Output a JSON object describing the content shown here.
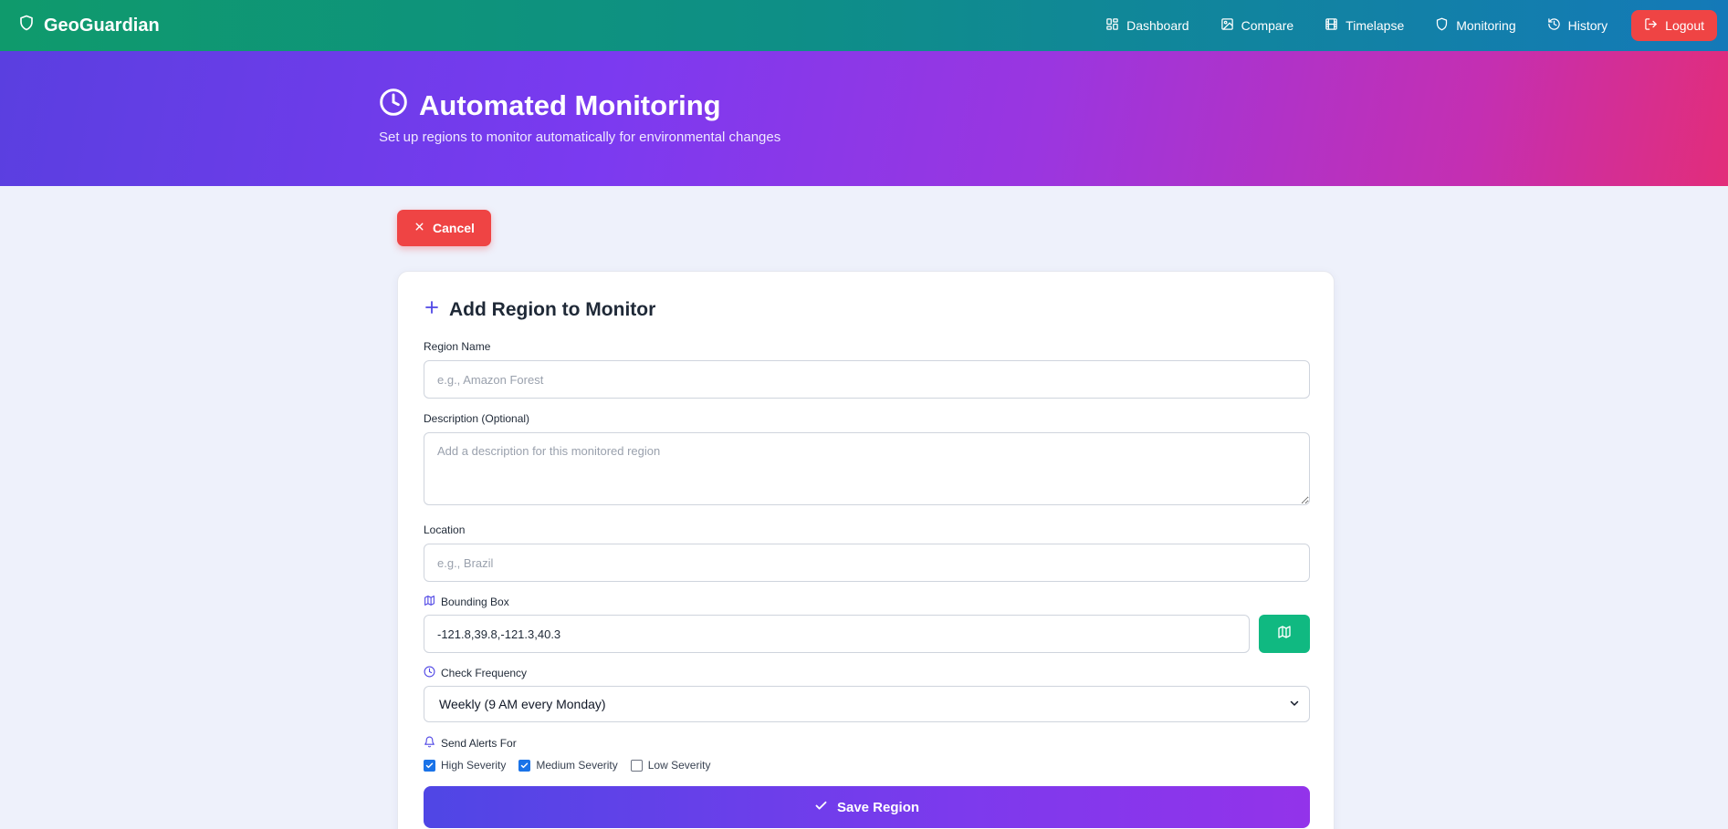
{
  "nav": {
    "brand": "GeoGuardian",
    "links": [
      {
        "label": "Dashboard",
        "icon": "dashboard-icon"
      },
      {
        "label": "Compare",
        "icon": "image-icon"
      },
      {
        "label": "Timelapse",
        "icon": "film-icon"
      },
      {
        "label": "Monitoring",
        "icon": "shield-icon"
      },
      {
        "label": "History",
        "icon": "history-icon"
      }
    ],
    "logout": "Logout"
  },
  "hero": {
    "title": "Automated Monitoring",
    "subtitle": "Set up regions to monitor automatically for environmental changes"
  },
  "cancel_label": "Cancel",
  "form": {
    "title": "Add Region to Monitor",
    "region_name": {
      "label": "Region Name",
      "placeholder": "e.g., Amazon Forest",
      "value": ""
    },
    "description": {
      "label": "Description (Optional)",
      "placeholder": "Add a description for this monitored region",
      "value": ""
    },
    "location": {
      "label": "Location",
      "placeholder": "e.g., Brazil",
      "value": ""
    },
    "bounding_box": {
      "label": "Bounding Box",
      "value": "-121.8,39.8,-121.3,40.3"
    },
    "check_frequency": {
      "label": "Check Frequency",
      "selected": "Weekly (9 AM every Monday)"
    },
    "alerts": {
      "label": "Send Alerts For",
      "options": [
        {
          "label": "High Severity",
          "checked": true
        },
        {
          "label": "Medium Severity",
          "checked": true
        },
        {
          "label": "Low Severity",
          "checked": false
        }
      ]
    },
    "save_label": "Save Region"
  },
  "colors": {
    "nav_start": "#0f9a6c",
    "nav_end": "#1479b8",
    "hero_start": "#5a3fe0",
    "hero_end": "#e22d7a",
    "danger": "#ef4444",
    "map_button": "#10b981",
    "accent": "#4f46e5"
  }
}
